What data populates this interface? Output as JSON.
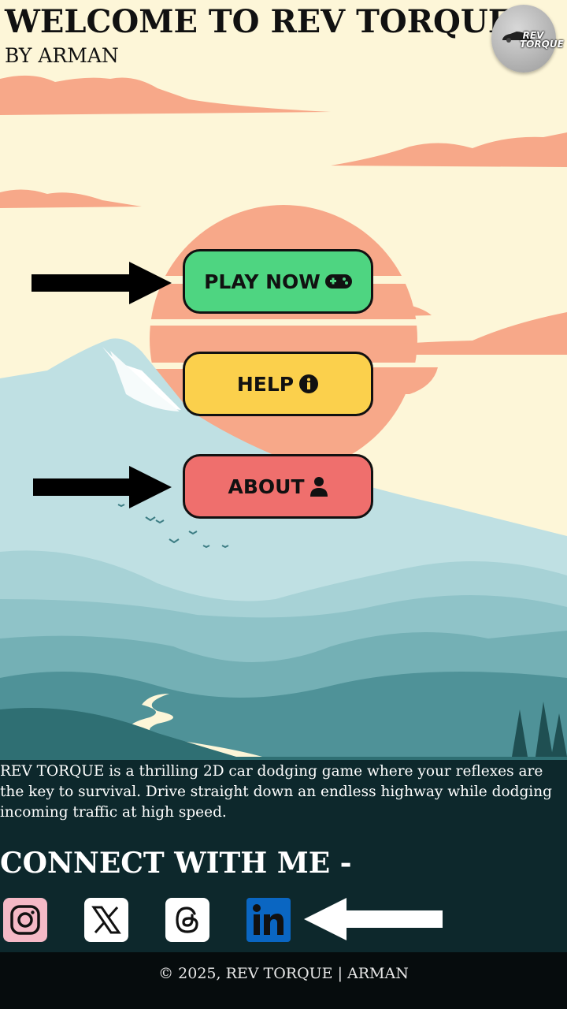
{
  "header": {
    "title": "WELCOME TO REV TORQUE",
    "subtitle": "BY ARMAN",
    "logo_text": "REV TORQUE"
  },
  "menu": {
    "play_label": "PLAY NOW",
    "help_label": "HELP",
    "about_label": "ABOUT"
  },
  "description": {
    "lines": [
      "REV TORQUE is a thrilling 2D car dodging game where your reflexes are",
      "the key to survival. Drive straight down an endless highway while dodging",
      "incoming traffic at high speed."
    ]
  },
  "connect": {
    "heading": "CONNECT WITH ME -",
    "links": [
      "instagram-icon",
      "x-icon",
      "threads-icon",
      "linkedin-icon"
    ]
  },
  "footer": {
    "copyright": "© 2025, REV TORQUE | ARMAN"
  },
  "colors": {
    "play": "#4ed581",
    "help": "#fbd04c",
    "about": "#ef6f6d",
    "sky": "#fdf6d8",
    "sun": "#f7a889"
  }
}
